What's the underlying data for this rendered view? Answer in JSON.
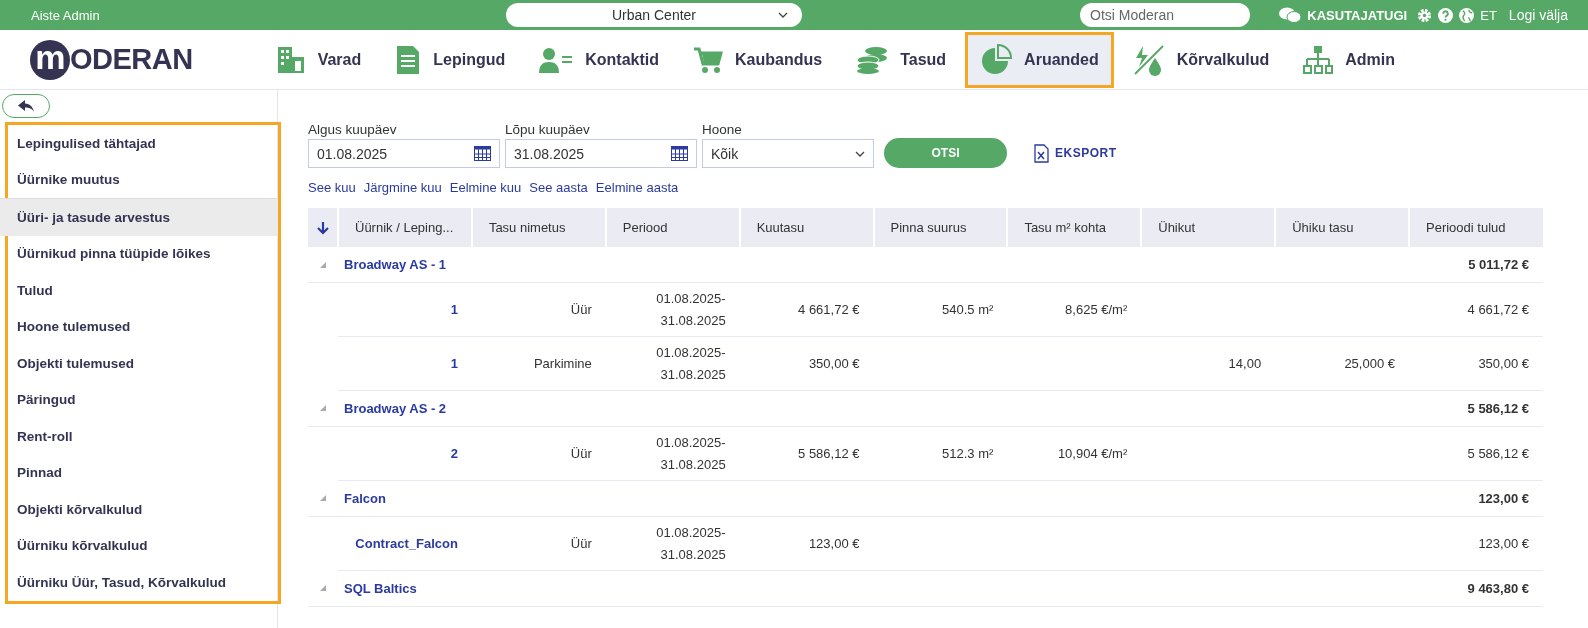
{
  "top_bar": {
    "user": "Aiste Admin",
    "building": "Urban Center",
    "search": {
      "placeholder": "Otsi Moderan"
    },
    "support": "KASUTAJATUGI",
    "language": "ET",
    "logout": "Logi välja"
  },
  "logo": {
    "mark": "m",
    "text": "ODERAN"
  },
  "nav": [
    {
      "label": "Varad",
      "selected": false
    },
    {
      "label": "Lepingud",
      "selected": false
    },
    {
      "label": "Kontaktid",
      "selected": false
    },
    {
      "label": "Kaubandus",
      "selected": false
    },
    {
      "label": "Tasud",
      "selected": false
    },
    {
      "label": "Aruanded",
      "selected": true
    },
    {
      "label": "Kõrvalkulud",
      "selected": false
    },
    {
      "label": "Admin",
      "selected": false
    }
  ],
  "sidebar": {
    "items": [
      {
        "label": "Lepingulised tähtajad",
        "selected": false
      },
      {
        "label": "Üürnike muutus",
        "selected": false
      },
      {
        "label": "Üüri- ja tasude arvestus",
        "selected": true
      },
      {
        "label": "Üürnikud pinna tüüpide lõikes",
        "selected": false
      },
      {
        "label": "Tulud",
        "selected": false
      },
      {
        "label": "Hoone tulemused",
        "selected": false
      },
      {
        "label": "Objekti tulemused",
        "selected": false
      },
      {
        "label": "Päringud",
        "selected": false
      },
      {
        "label": "Rent-roll",
        "selected": false
      },
      {
        "label": "Pinnad",
        "selected": false
      },
      {
        "label": "Objekti kõrvalkulud",
        "selected": false
      },
      {
        "label": "Üürniku kõrvalkulud",
        "selected": false
      },
      {
        "label": "Üürniku Üür, Tasud, Kõrvalkulud",
        "selected": false
      }
    ]
  },
  "filters": {
    "start": {
      "label": "Algus kuupäev",
      "value": "01.08.2025"
    },
    "end": {
      "label": "Lõpu kuupäev",
      "value": "31.08.2025"
    },
    "building": {
      "label": "Hoone",
      "value": "Kõik"
    },
    "search_button": "OTSI",
    "export_button": "EKSPORT",
    "quick_links": [
      "See kuu",
      "Järgmine kuu",
      "Eelmine kuu",
      "See aasta",
      "Eelmine aasta"
    ]
  },
  "table": {
    "columns": [
      "Üürnik / Leping...",
      "Tasu nimetus",
      "Periood",
      "Kuutasu",
      "Pinna suurus",
      "Tasu m² kohta",
      "Ühikut",
      "Ühiku tasu",
      "Perioodi tulud"
    ],
    "groups": [
      {
        "name": "Broadway AS - 1",
        "total": "5 011,72 €",
        "expanded": true,
        "rows": [
          [
            "1",
            "Üür",
            "01.08.2025-31.08.2025",
            "4 661,72 €",
            "540.5 m²",
            "8,625 €/m²",
            "",
            "",
            "4 661,72 €"
          ],
          [
            "1",
            "Parkimine",
            "01.08.2025-31.08.2025",
            "350,00 €",
            "",
            "",
            "14,00",
            "25,000 €",
            "350,00 €"
          ]
        ]
      },
      {
        "name": "Broadway AS - 2",
        "total": "5 586,12 €",
        "expanded": true,
        "rows": [
          [
            "2",
            "Üür",
            "01.08.2025-31.08.2025",
            "5 586,12 €",
            "512.3 m²",
            "10,904 €/m²",
            "",
            "",
            "5 586,12 €"
          ]
        ]
      },
      {
        "name": "Falcon",
        "total": "123,00 €",
        "expanded": true,
        "rows": [
          [
            "Contract_Falcon",
            "Üür",
            "01.08.2025-31.08.2025",
            "123,00 €",
            "",
            "",
            "",
            "",
            "123,00 €"
          ]
        ]
      },
      {
        "name": "SQL Baltics",
        "total": "9 463,80 €",
        "expanded": true
      }
    ]
  }
}
